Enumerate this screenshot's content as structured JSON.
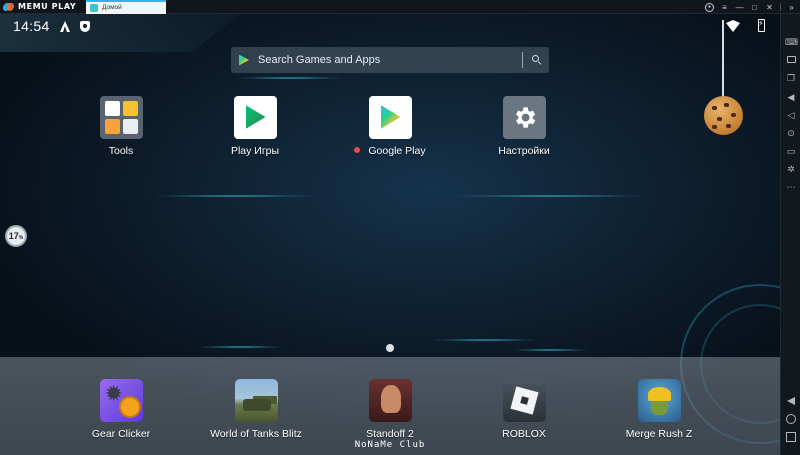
{
  "titlebar": {
    "logo_text": "MEMU PLAY",
    "tab_label": "Домой"
  },
  "status": {
    "time": "14:54"
  },
  "search": {
    "placeholder": "Search Games and Apps"
  },
  "apps": [
    {
      "label": "Tools",
      "icon": "tools-folder-icon"
    },
    {
      "label": "Play Игры",
      "icon": "play-games-icon"
    },
    {
      "label": "Google Play",
      "icon": "google-play-icon",
      "new": true
    },
    {
      "label": "Настройки",
      "icon": "settings-gear-icon"
    }
  ],
  "dock": [
    {
      "label": "Gear Clicker",
      "icon": "gear-clicker-icon"
    },
    {
      "label": "World of Tanks Blitz",
      "icon": "world-of-tanks-icon"
    },
    {
      "label": "Standoff 2",
      "sub": "NoNaMe Club",
      "icon": "standoff-icon"
    },
    {
      "label": "ROBLOX",
      "icon": "roblox-icon"
    },
    {
      "label": "Merge Rush Z",
      "icon": "merge-rush-icon"
    }
  ],
  "floating_badge": {
    "value": "17",
    "unit": "%"
  },
  "colors": {
    "accent": "#2fb6e8",
    "new_dot": "#f04848"
  }
}
